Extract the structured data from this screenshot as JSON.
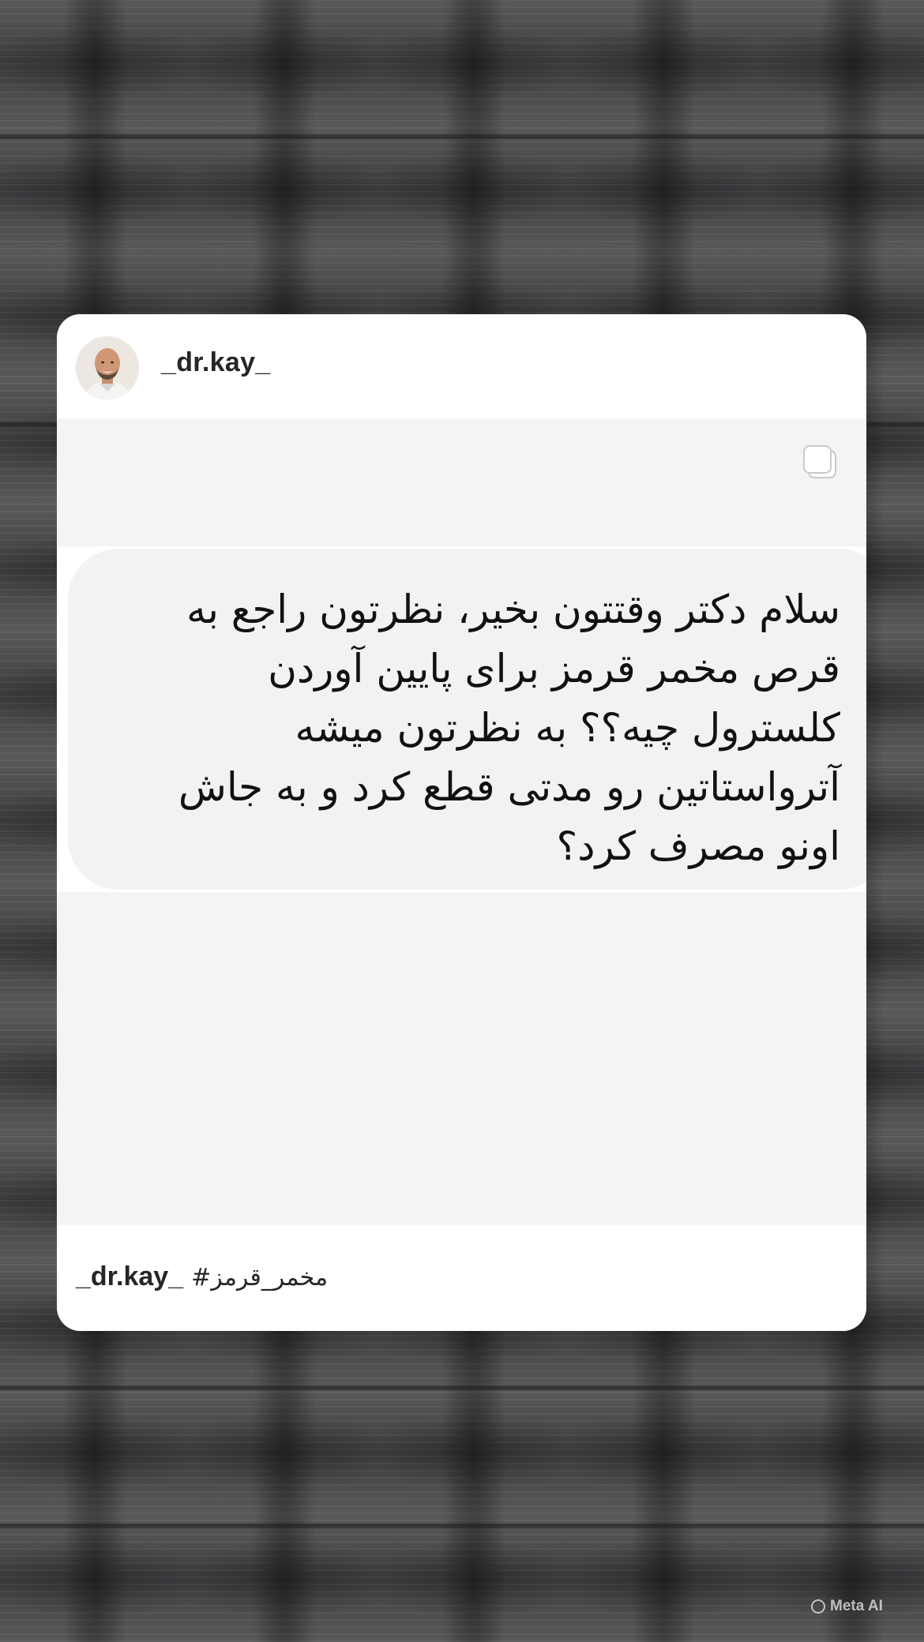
{
  "post": {
    "username": "_dr.kay_",
    "avatar_icon": "profile-photo-bald-man-smiling",
    "multi_media_icon": "carousel-icon",
    "message": "سلام دکتر وقتتون بخیر، نظرتون راجع به\nقرص مخمر قرمز  برای پایین آوردن\nکلسترول چیه؟؟ به نظرتون میشه\nآترواستاتین رو مدتی قطع کرد و به جاش\nاونو مصرف کرد؟",
    "caption_user": "_dr.kay_",
    "caption_text": "#مخمر_قرمز"
  },
  "watermark": {
    "label": "Meta AI",
    "icon": "meta-ai-ring-icon"
  },
  "colors": {
    "card_bg": "#ffffff",
    "media_bg": "#f3f4f4",
    "bubble_bg": "#f1f2f4",
    "text": "#262626",
    "page_bg": "#4a4b4d"
  }
}
